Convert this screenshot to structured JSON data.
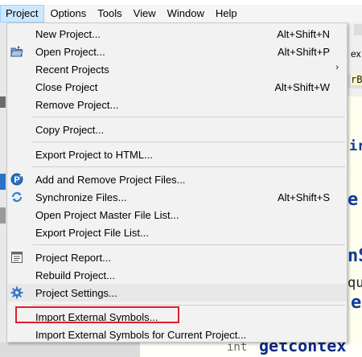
{
  "menubar": {
    "items": [
      "Project",
      "Options",
      "Tools",
      "View",
      "Window",
      "Help"
    ]
  },
  "background": {
    "tab_fragment": "ex",
    "frag_b": "rB",
    "frag_ir": "ir",
    "frag_e": "e",
    "frag_nS": "nS",
    "frag_qu": "qu",
    "code_int": "int",
    "code_func": "getcontex"
  },
  "project_menu": {
    "items": [
      {
        "label": "New Project...",
        "shortcut": "Alt+Shift+N"
      },
      {
        "label": "Open Project...",
        "shortcut": "Alt+Shift+P"
      },
      {
        "label": "Recent Projects",
        "submenu": "›"
      },
      {
        "label": "Close Project",
        "shortcut": "Alt+Shift+W"
      },
      {
        "label": "Remove Project..."
      },
      {
        "label": "Copy Project..."
      },
      {
        "label": "Export Project to HTML..."
      },
      {
        "label": "Add and Remove Project Files..."
      },
      {
        "label": "Synchronize Files...",
        "shortcut": "Alt+Shift+S"
      },
      {
        "label": "Open Project Master File List..."
      },
      {
        "label": "Export Project File List..."
      },
      {
        "label": "Project Report..."
      },
      {
        "label": "Rebuild Project..."
      },
      {
        "label": "Project Settings..."
      },
      {
        "label": "Import External Symbols..."
      },
      {
        "label": "Import External Symbols for Current Project..."
      }
    ]
  },
  "colors": {
    "highlight_border": "#e0202a",
    "menu_background": "#f2f2f2",
    "menubar_open": "#cce8ff"
  }
}
